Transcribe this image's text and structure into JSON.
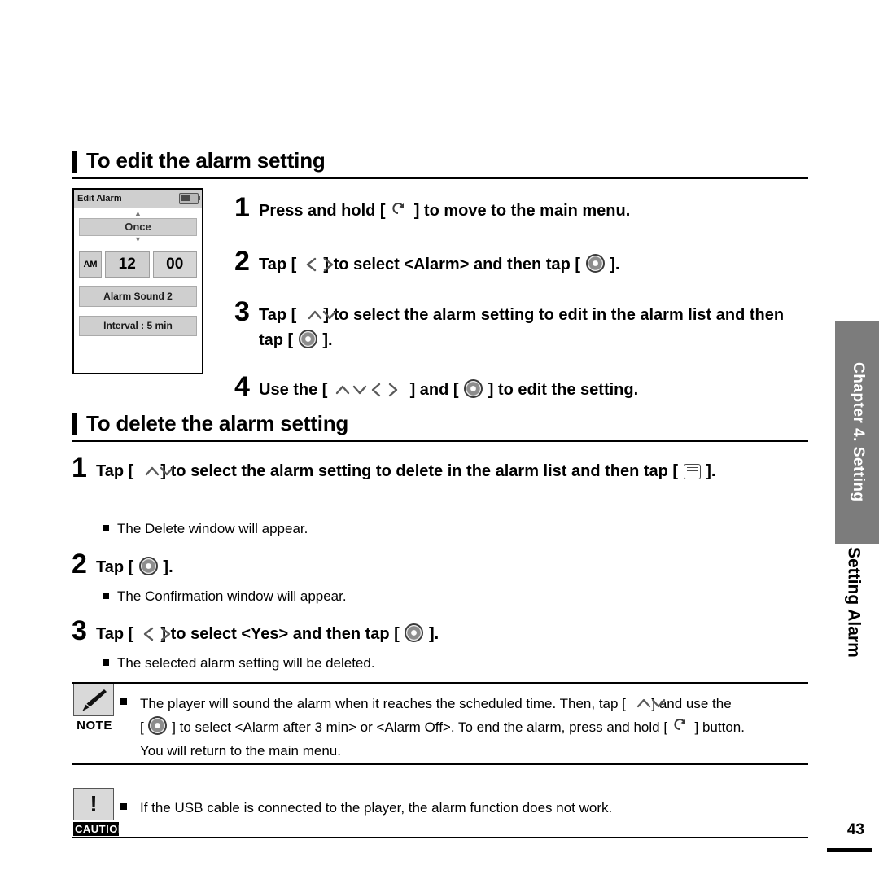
{
  "sections": {
    "edit": {
      "title": "To edit the alarm setting",
      "steps": [
        {
          "num": "1",
          "parts": [
            "Press and hold [",
            "] to move to the main menu."
          ],
          "icons": [
            "return-key-icon"
          ]
        },
        {
          "num": "2",
          "parts": [
            "Tap [",
            "] to select <Alarm> and then tap [",
            "]."
          ],
          "icons": [
            "left-right-key-icon",
            "select-key-icon"
          ]
        },
        {
          "num": "3",
          "parts": [
            "Tap [",
            "] to select the alarm setting to edit in the alarm list and then tap [",
            "]."
          ],
          "icons": [
            "up-down-key-icon",
            "select-key-icon"
          ]
        },
        {
          "num": "4",
          "parts": [
            "Use the [",
            "] and [",
            "] to edit the setting."
          ],
          "icons": [
            "four-way-key-icon",
            "select-key-icon"
          ]
        }
      ]
    },
    "delete": {
      "title": "To delete the alarm setting",
      "steps": [
        {
          "num": "1",
          "parts": [
            "Tap [",
            "] to select the alarm setting to delete in the alarm list and then tap [",
            "]."
          ],
          "icons": [
            "up-down-key-icon",
            "menu-key-icon"
          ],
          "note": "The Delete window will appear."
        },
        {
          "num": "2",
          "parts": [
            "Tap [",
            "]."
          ],
          "icons": [
            "select-key-icon"
          ],
          "note": "The Confirmation window will appear."
        },
        {
          "num": "3",
          "parts": [
            "Tap [",
            "] to select <Yes> and then tap [",
            "]."
          ],
          "icons": [
            "left-right-key-icon",
            "select-key-icon"
          ],
          "note": "The selected alarm setting will be deleted."
        }
      ]
    }
  },
  "device_screen": {
    "title": "Edit Alarm",
    "repeat": "Once",
    "ampm": "AM",
    "hour": "12",
    "minute": "00",
    "alarm_sound": "Alarm Sound 2",
    "interval": "Interval : 5 min"
  },
  "note": {
    "label": "NOTE",
    "line1_a": "The player will sound the alarm when it reaches the scheduled time. Then, tap [",
    "line1_b": "] and use the",
    "line2_a": "[",
    "line2_b": "] to select <Alarm after 3 min> or <Alarm Off>. To end the alarm, press and hold [",
    "line2_c": "] button.",
    "line3": "You will return to the main menu."
  },
  "caution": {
    "label": "CAUTION",
    "mark": "!",
    "text": "If the USB cable is connected to  the player, the alarm function does not work."
  },
  "sidebar": {
    "chapter": "Chapter 4. Setting",
    "title": "Setting Alarm"
  },
  "page_number": "43"
}
